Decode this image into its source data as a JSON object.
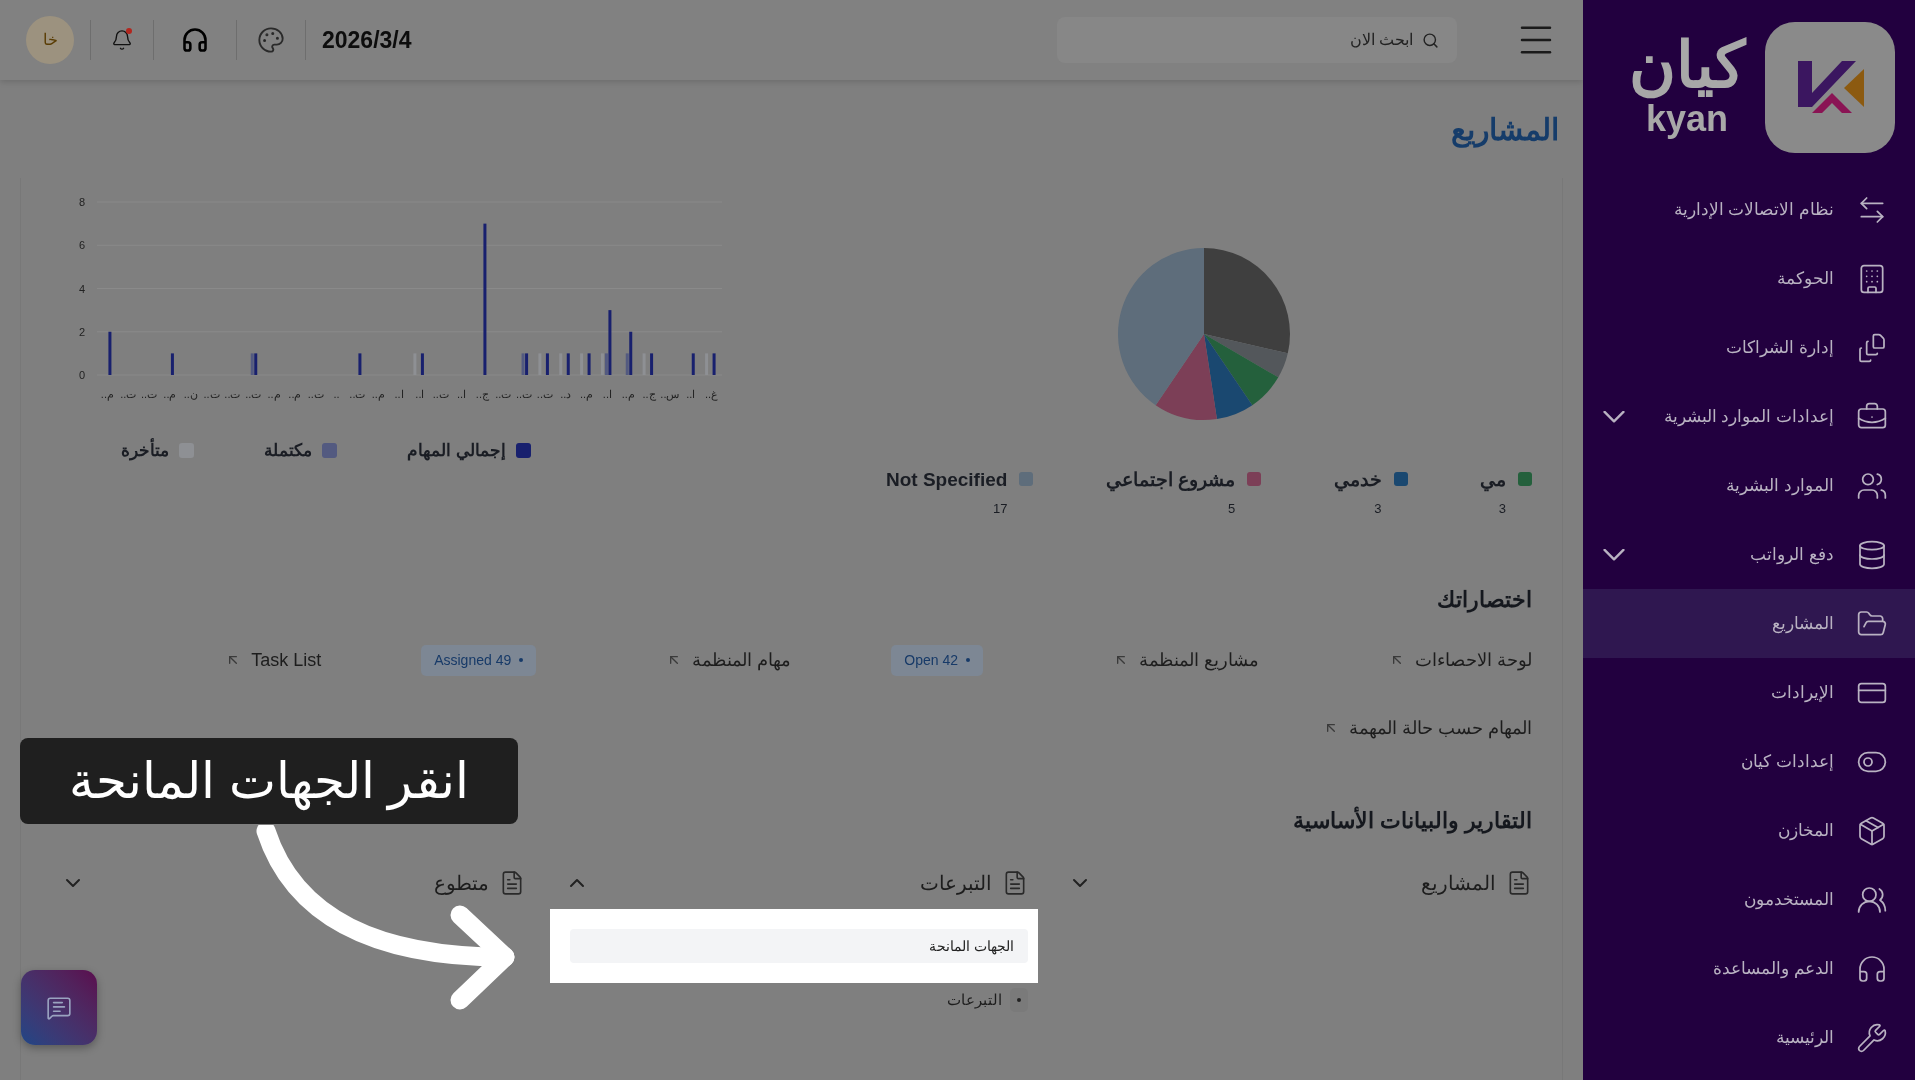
{
  "topbar": {
    "avatar": "خا",
    "has_notification": true,
    "date": "2026/3/4",
    "search": {
      "placeholder": "ابحث الان"
    }
  },
  "page_title": "المشاريع",
  "tasks_chart": {
    "chart_data": {
      "type": "bar",
      "grid": true,
      "categories": [
        "م..",
        "ت..",
        "ت..",
        "م..",
        "ن..",
        "ت..",
        "ت..",
        "ت..",
        "م..",
        "م..",
        "ت..",
        "..",
        "ت..",
        "م..",
        "ا..",
        "ا..",
        "ت..",
        "ا..",
        "ج..",
        "ت..",
        "ت..",
        "ت..",
        "د..",
        "م..",
        "ا..",
        "م..",
        "ج..",
        "س..",
        "ا..",
        "غ.."
      ],
      "yticks": [
        0,
        2,
        4,
        6,
        8
      ],
      "ylim": [
        0,
        8
      ],
      "series": [
        {
          "name": "إجمالي المهام",
          "color": "#18206e",
          "values": [
            2,
            0,
            0,
            1,
            0,
            0,
            0,
            1,
            0,
            0,
            0,
            0,
            1,
            0,
            0,
            1,
            0,
            0,
            7,
            0,
            1,
            1,
            1,
            1,
            3,
            2,
            1,
            0,
            1,
            1
          ]
        },
        {
          "name": "مكتملة",
          "color": "#535a80",
          "values": [
            0,
            0,
            0,
            0,
            0,
            0,
            0,
            1,
            0,
            0,
            0,
            0,
            0,
            0,
            0,
            0,
            0,
            0,
            0,
            0,
            1,
            0,
            0,
            0,
            1,
            1,
            0,
            0,
            0,
            0
          ]
        },
        {
          "name": "متأخرة",
          "color": "#8e9094",
          "values": [
            0,
            0,
            0,
            0,
            0,
            0,
            0,
            0,
            0,
            0,
            0,
            0,
            0,
            0,
            0,
            1,
            0,
            0,
            0,
            0,
            0,
            1,
            1,
            1,
            1,
            0,
            1,
            0,
            0,
            1
          ]
        }
      ]
    }
  },
  "project_types_chart": {
    "chart_data": {
      "type": "pie",
      "categories": [
        null,
        null,
        "مي",
        "خدمي",
        "مشروع اجتماعي",
        "Not Specified"
      ],
      "series": [
        {
          "values": [
            28.6,
            4.8,
            7.1,
            7.1,
            11.9,
            40.5
          ]
        }
      ],
      "colors": [
        "#3f3f3f",
        "#53575b",
        "#24603c",
        "#1a4870",
        "#7c3f57",
        "#5e6d7b"
      ],
      "legend": "bottom",
      "value_labels": [
        null,
        null,
        "3",
        "3",
        "5",
        "17"
      ]
    }
  },
  "shortcuts": {
    "title": "اختصاراتك",
    "rows": [
      [
        {
          "kind": "link",
          "label": "لوحة الاحصاءات"
        },
        {
          "kind": "link",
          "label": "مشاريع المنظمة"
        },
        {
          "kind": "badge",
          "label": "Open 42"
        },
        {
          "kind": "link",
          "label": "مهام المنظمة"
        },
        {
          "kind": "badge",
          "label": "Assigned 49"
        },
        {
          "kind": "link",
          "label": "Task List"
        }
      ],
      [
        {
          "kind": "link",
          "label": "المهام حسب حالة المهمة"
        }
      ]
    ]
  },
  "reports": {
    "title": "التقارير والبيانات الأساسية",
    "groups": [
      {
        "label": "المشاريع",
        "expanded": false
      },
      {
        "label": "التبرعات",
        "expanded": true,
        "items": [
          {
            "label": "الجهات المانحة",
            "highlighted": true
          },
          {
            "label": "التبرعات",
            "highlighted": false
          }
        ]
      },
      {
        "label": "متطوع",
        "expanded": false
      }
    ]
  },
  "tutorial": {
    "callout": "انقر الجهات المانحة"
  },
  "sidebar": {
    "logo": {
      "arabic": "كيان",
      "latin": "kyan"
    },
    "items": [
      {
        "label": "نظام الاتصالات الإدارية",
        "selected": false,
        "expandable": false
      },
      {
        "label": "الحوكمة",
        "selected": false,
        "expandable": false
      },
      {
        "label": "إدارة الشراكات",
        "selected": false,
        "expandable": false
      },
      {
        "label": "إعدادات الموارد البشرية",
        "selected": false,
        "expandable": true
      },
      {
        "label": "الموارد البشرية",
        "selected": false,
        "expandable": false
      },
      {
        "label": "دفع الرواتب",
        "selected": false,
        "expandable": true
      },
      {
        "label": "المشاريع",
        "selected": true,
        "expandable": false
      },
      {
        "label": "الإيرادات",
        "selected": false,
        "expandable": false
      },
      {
        "label": "إعدادات كيان",
        "selected": false,
        "expandable": false
      },
      {
        "label": "المخازن",
        "selected": false,
        "expandable": false
      },
      {
        "label": "المستخدمون",
        "selected": false,
        "expandable": false
      },
      {
        "label": "الدعم والمساعدة",
        "selected": false,
        "expandable": false
      },
      {
        "label": "الرئيسية",
        "selected": false,
        "expandable": false
      }
    ]
  }
}
